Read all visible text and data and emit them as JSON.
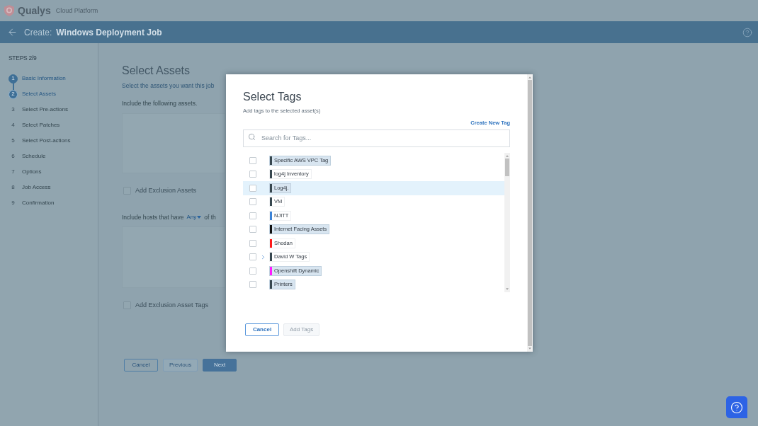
{
  "app_bar": {
    "logo_text": "Qualys",
    "product": "Cloud Platform"
  },
  "header": {
    "prefix": "Create:",
    "title": "Windows Deployment Job"
  },
  "steps": {
    "counter": "STEPS 2/9",
    "items": [
      {
        "number": "1",
        "label": "Basic Information",
        "completed": true,
        "selected": false
      },
      {
        "number": "2",
        "label": "Select Assets",
        "completed": false,
        "selected": true
      },
      {
        "number": "3",
        "label": "Select Pre-actions",
        "completed": false,
        "selected": false
      },
      {
        "number": "4",
        "label": "Select Patches",
        "completed": false,
        "selected": false
      },
      {
        "number": "5",
        "label": "Select Post-actions",
        "completed": false,
        "selected": false
      },
      {
        "number": "6",
        "label": "Schedule",
        "completed": false,
        "selected": false
      },
      {
        "number": "7",
        "label": "Options",
        "completed": false,
        "selected": false
      },
      {
        "number": "8",
        "label": "Job Access",
        "completed": false,
        "selected": false
      },
      {
        "number": "9",
        "label": "Confirmation",
        "completed": false,
        "selected": false
      }
    ]
  },
  "page": {
    "title": "Select Assets",
    "subtitle": "Select the assets you want this job",
    "include_label": "Include the following assets.",
    "exclusion_assets": {
      "label": "Add Exclusion Assets",
      "checked": false
    },
    "hosts_prefix": "Include hosts that have",
    "hosts_operator": "Any",
    "hosts_suffix": "of th",
    "exclusion_tags": {
      "label": "Add Exclusion Asset Tags",
      "checked": false
    },
    "buttons": [
      {
        "label": "Cancel",
        "kind": "outline"
      },
      {
        "label": "Previous",
        "kind": "disabled"
      },
      {
        "label": "Next",
        "kind": "primary"
      }
    ]
  },
  "dialog": {
    "title": "Select Tags",
    "subtitle": "Add tags to the selected asset(s)",
    "create_link": "Create New Tag",
    "search": {
      "placeholder": "Search for Tags..."
    },
    "tags": [
      {
        "name": "Specific AWS VPC Tag",
        "color": "#37474f",
        "tinted": true,
        "checked": false,
        "expandable": false,
        "selected": false
      },
      {
        "name": "log4j Inventory",
        "color": "#37474f",
        "tinted": false,
        "checked": false,
        "expandable": false,
        "selected": false
      },
      {
        "name": "Log4j.",
        "color": "#37474f",
        "tinted": true,
        "checked": false,
        "expandable": false,
        "selected": true
      },
      {
        "name": "VM",
        "color": "#37474f",
        "tinted": false,
        "checked": false,
        "expandable": false,
        "selected": false
      },
      {
        "name": "NJITT",
        "color": "#3b82d6",
        "tinted": false,
        "checked": false,
        "expandable": false,
        "selected": false
      },
      {
        "name": "Internet Facing Assets",
        "color": "#111111",
        "tinted": true,
        "checked": false,
        "expandable": false,
        "selected": false
      },
      {
        "name": "Shodan",
        "color": "#ff1a1a",
        "tinted": false,
        "checked": false,
        "expandable": false,
        "selected": false
      },
      {
        "name": "David W Tags",
        "color": "#37474f",
        "tinted": false,
        "checked": false,
        "expandable": true,
        "selected": false
      },
      {
        "name": "Openshift Dynamic",
        "color": "#ff1aff",
        "tinted": true,
        "checked": false,
        "expandable": false,
        "selected": false
      },
      {
        "name": "Printers",
        "color": "#37474f",
        "tinted": true,
        "checked": false,
        "expandable": false,
        "selected": false
      }
    ],
    "buttons": [
      {
        "label": "Cancel",
        "kind": "outline"
      },
      {
        "label": "Add Tags",
        "kind": "disabled"
      }
    ]
  }
}
